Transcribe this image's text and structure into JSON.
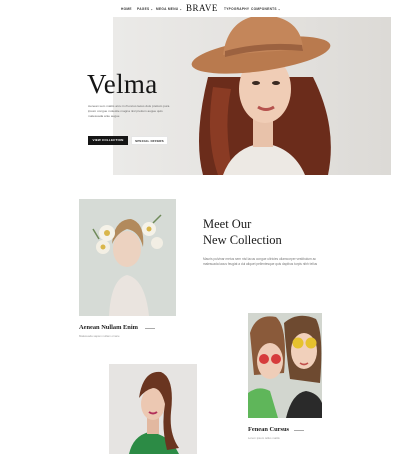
{
  "nav": {
    "items": [
      {
        "label": "HOME",
        "caret": ""
      },
      {
        "label": "PAGES",
        "caret": "⌄"
      },
      {
        "label": "MEGA MENU",
        "caret": "⌄"
      },
      {
        "label": "TYPOGRAPHY",
        "caret": ""
      },
      {
        "label": "COMPONENTS",
        "caret": "⌄"
      }
    ],
    "logo": "BRAVE"
  },
  "hero": {
    "title": "Velma",
    "text": "Aenean sem mattis arcu in rhoncus lacus duis pretium pura ipsum congue molestie magna nisl pretium augue quis malesuada ante augue",
    "primary_button": "VIEW COLLECTION",
    "secondary_button": "SPECIAL OFFERS"
  },
  "collection": {
    "heading_line1": "Meet Our",
    "heading_line2": "New Collection",
    "text": "Mauris pulvinar metus sem nisl lacus congue ultricies ullamcorper vestibulum ac malesuada lacus feugiat a dui aliquet pellentesque quis dapibus turpis nibh tellus"
  },
  "cards": [
    {
      "title": "Aenean Nullam Enim",
      "subtitle": "Malesuada sapien nullam ornare"
    },
    {
      "title": "Fenean Cursus",
      "subtitle": "Lorem ipsum tellus mattis"
    }
  ],
  "colors": {
    "accent": "#151515",
    "hero_bg": "#e6e4e1",
    "hat": "#b97a4e",
    "hair": "#6b2c1b"
  }
}
